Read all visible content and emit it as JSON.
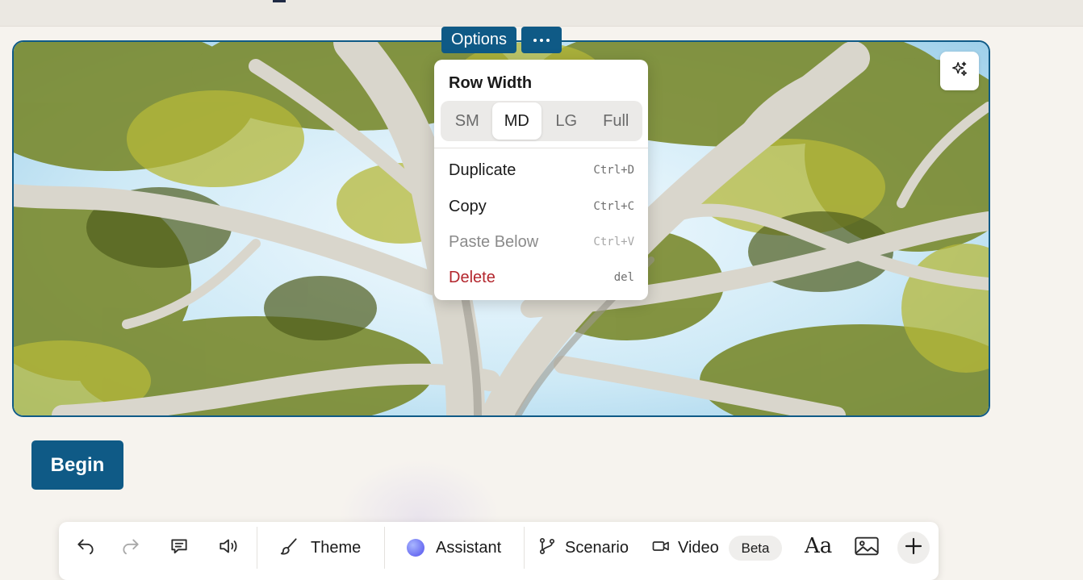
{
  "block": {
    "options_label": "Options",
    "more_icon": "more-horizontal-icon",
    "ai_icon": "sparkles-icon"
  },
  "menu": {
    "row_width_title": "Row Width",
    "widths": [
      {
        "label": "SM",
        "active": false
      },
      {
        "label": "MD",
        "active": true
      },
      {
        "label": "LG",
        "active": false
      },
      {
        "label": "Full",
        "active": false
      }
    ],
    "items": [
      {
        "label": "Duplicate",
        "shortcut": "Ctrl+D",
        "state": "normal"
      },
      {
        "label": "Copy",
        "shortcut": "Ctrl+C",
        "state": "normal"
      },
      {
        "label": "Paste Below",
        "shortcut": "Ctrl+V",
        "state": "disabled"
      },
      {
        "label": "Delete",
        "shortcut": "del",
        "state": "danger"
      }
    ]
  },
  "begin_label": "Begin",
  "toolbar": {
    "undo_icon": "undo-icon",
    "redo_icon": "redo-icon",
    "comment_icon": "comment-icon",
    "audio_icon": "speaker-icon",
    "theme_label": "Theme",
    "assistant_label": "Assistant",
    "scenario_label": "Scenario",
    "video_label": "Video",
    "beta_label": "Beta",
    "font_label": "Aa",
    "image_icon": "image-icon",
    "add_icon": "plus-icon"
  },
  "colors": {
    "accent": "#0f5a86",
    "danger": "#b3262d",
    "background": "#f6f3ee"
  }
}
